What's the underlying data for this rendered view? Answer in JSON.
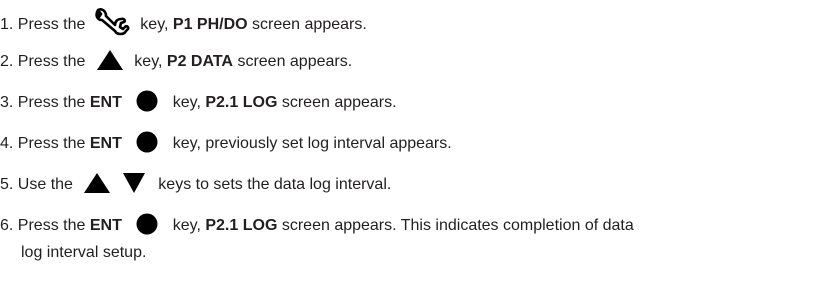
{
  "steps": [
    {
      "num": "1.",
      "parts": [
        "Press the",
        "key,",
        "P1 PH/DO",
        "screen appears."
      ]
    },
    {
      "num": "2.",
      "parts": [
        "Press the",
        "key,",
        "P2 DATA",
        "screen appears."
      ]
    },
    {
      "num": "3.",
      "parts": [
        "Press the",
        "ENT",
        "key,",
        "P2.1 LOG",
        "screen appears."
      ]
    },
    {
      "num": "4.",
      "parts": [
        "Press the",
        "ENT",
        "key, previously set log interval appears."
      ]
    },
    {
      "num": "5.",
      "parts": [
        "Use the",
        "keys to sets the data log interval."
      ]
    },
    {
      "num": "6.",
      "parts": [
        "Press the",
        "ENT",
        "key,",
        "P2.1 LOG",
        "screen appears. This indicates completion of data"
      ],
      "continuation": "log interval setup."
    }
  ],
  "icons": {
    "step1": "wrench-icon",
    "step2": "up-triangle-icon",
    "step3": "filled-circle-icon",
    "step4": "filled-circle-icon",
    "step5": [
      "up-triangle-icon",
      "down-triangle-icon"
    ],
    "step6": "filled-circle-icon"
  },
  "colors": {
    "text": "#231f20",
    "icon": "#000000"
  }
}
